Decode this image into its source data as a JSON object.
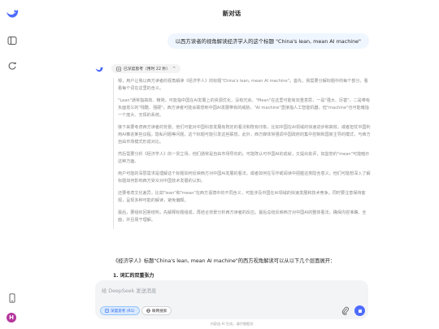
{
  "header": {
    "title": "新对话"
  },
  "user_message": "以西方读者的视角解读经济学人的这个标题 \"China's lean, mean AI machine\"",
  "thinking_chip": {
    "label": "已深度思考（用时 22 秒）",
    "chevron": "^"
  },
  "reasoning": [
    "嗯，用户让我以西方读者的视角解读《经济学人》的标题\"China's lean, mean AI machine\"。首先，我需要分解标题中的每个部分，看看每个词在这里的含义。",
    "\"Lean\"通常指高效、精简，可能指中国在AI发展上的资源优化，没有冗余。\"Mean\"在这里可能有双重意思，一是\"强大、厉害\"，二是带有负面意义的\"残酷、强硬\"。西方读者可能会联想到中国AI发展带有的威胁。\"AI machine\"直接指人工智能机器，但\"machine\"也可能暗指一个庞大、无情的系统。",
    "接下来要考虑西方读者的背景。他们可能对中国科技发展有既定的看法和既有印象，比如中国在AI领域的快速进步和高效，或者担忧中国利用AI推进某些议程。隐私问题等问题，这个标题可能引发这些联想。此外，西方媒体常强调中国政府的集中控制和国家主导的模式，与西方自由市场模式形成对比。",
    "然后需要分析《经济学人》的一贯立场，他们通常是自由市场导向的。可能既认可中国AI的成就，又提出批评，如监管的\"mean\"可能暗示这种方面。",
    "用户可能的深层需求是理解这个标题如何反映西方对中国AI发展的看法，或者如何在写作或阅读中把握这类隐含意义。他们可能想深入了解标题如何影响西方受众对中国技术发展的认知。",
    "还要考虑文化差异，比如\"lean\"和\"mean\"在西方语境中的不同含义，可能涉及中国在AI领域的快速发展和技术竞争。同时要注意保持客观，呈现多种可能的解读，避免偏颇。",
    "最后，要组织回答结构，先解释标题组成，再结合背景分析西方读者的反应。最后总结反映西方对中国AI的整体看法，确保内容准确、全面，并且易于理解。"
  ],
  "answer": {
    "intro": "《经济学人》标题\"China's lean, mean AI machine\"的西方视角解读可以从以下几个层面展开：",
    "heading": "1. 词汇的双重张力"
  },
  "composer": {
    "placeholder": "给 DeepSeek 发送消息",
    "deep_think_label": "深度思考 (R1)",
    "web_search_label": "联网搜索"
  },
  "footer": "内容由 AI 生成，请仔细甄别",
  "user": {
    "avatar_initial": "H"
  },
  "colors": {
    "accent": "#4d6bfe",
    "bubble": "#eff6ff",
    "avatar": "#b5369d"
  }
}
